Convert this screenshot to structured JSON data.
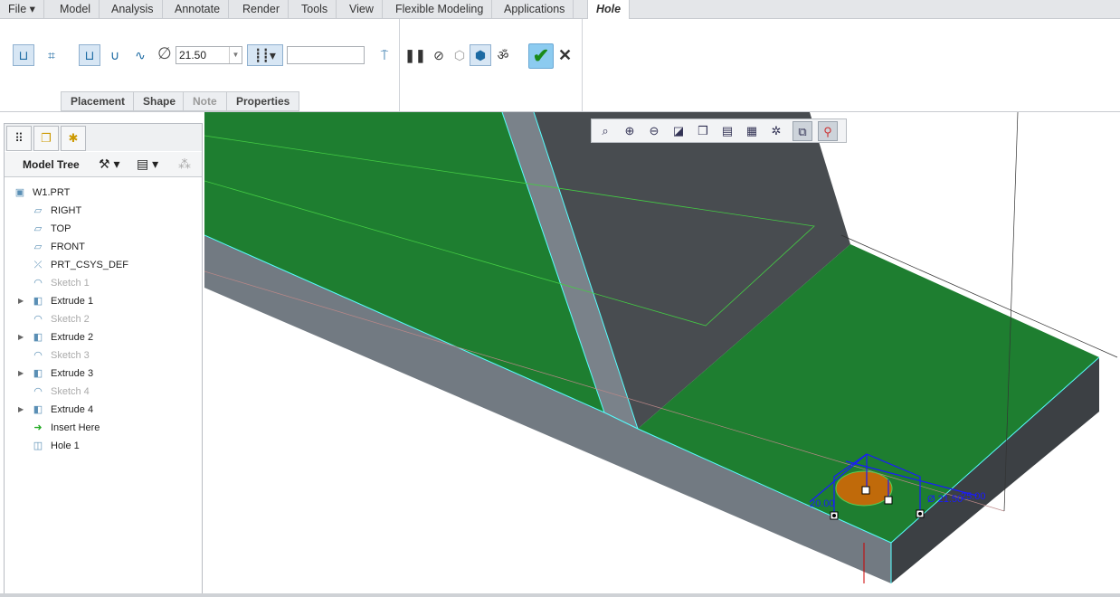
{
  "menu": {
    "file": "File ▾",
    "tabs": [
      "Model",
      "Analysis",
      "Annotate",
      "Render",
      "Tools",
      "View",
      "Flexible Modeling",
      "Applications"
    ],
    "active_tab": "Hole"
  },
  "ribbon": {
    "diameter": "21.50",
    "depth": "",
    "subtabs": [
      "Placement",
      "Shape",
      "Note",
      "Properties"
    ]
  },
  "tree": {
    "header": "Model Tree",
    "items": [
      {
        "label": "W1.PRT",
        "icon": "part-icon"
      },
      {
        "label": "RIGHT",
        "icon": "datum-plane-icon"
      },
      {
        "label": "TOP",
        "icon": "datum-plane-icon"
      },
      {
        "label": "FRONT",
        "icon": "datum-plane-icon"
      },
      {
        "label": "PRT_CSYS_DEF",
        "icon": "csys-icon"
      },
      {
        "label": "Sketch 1",
        "icon": "sketch-icon",
        "dim": true
      },
      {
        "label": "Extrude 1",
        "icon": "extrude-icon",
        "expand": true
      },
      {
        "label": "Sketch 2",
        "icon": "sketch-icon",
        "dim": true
      },
      {
        "label": "Extrude 2",
        "icon": "extrude-icon",
        "expand": true
      },
      {
        "label": "Sketch 3",
        "icon": "sketch-icon",
        "dim": true
      },
      {
        "label": "Extrude 3",
        "icon": "extrude-icon",
        "expand": true
      },
      {
        "label": "Sketch 4",
        "icon": "sketch-icon",
        "dim": true
      },
      {
        "label": "Extrude 4",
        "icon": "extrude-icon",
        "expand": true
      },
      {
        "label": "Insert Here",
        "icon": "insert-arrow-icon"
      },
      {
        "label": "Hole 1",
        "icon": "hole-icon"
      }
    ]
  },
  "viewport": {
    "dims": [
      "20.00",
      "Ø 21.50",
      "25.00"
    ],
    "colors": {
      "green": "#1e7e30",
      "grey": "#727a82",
      "dark": "#484c50",
      "hole": "#c06a0a",
      "dim": "#1a1aff"
    }
  }
}
